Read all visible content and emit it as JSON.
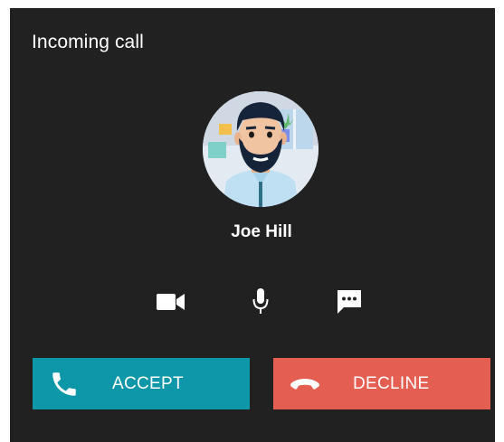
{
  "dialog": {
    "title": "Incoming call",
    "caller": {
      "name": "Joe Hill",
      "avatar_icon": "avatar-illustration"
    },
    "quick_actions": [
      {
        "icon": "video-camera-icon"
      },
      {
        "icon": "microphone-icon"
      },
      {
        "icon": "message-icon"
      }
    ],
    "accept": {
      "label": "ACCEPT",
      "icon": "phone-icon",
      "color": "#0e97a8"
    },
    "decline": {
      "label": "DECLINE",
      "icon": "hang-up-icon",
      "color": "#e45e52"
    }
  },
  "colors": {
    "background": "#212121",
    "text": "#ffffff"
  }
}
